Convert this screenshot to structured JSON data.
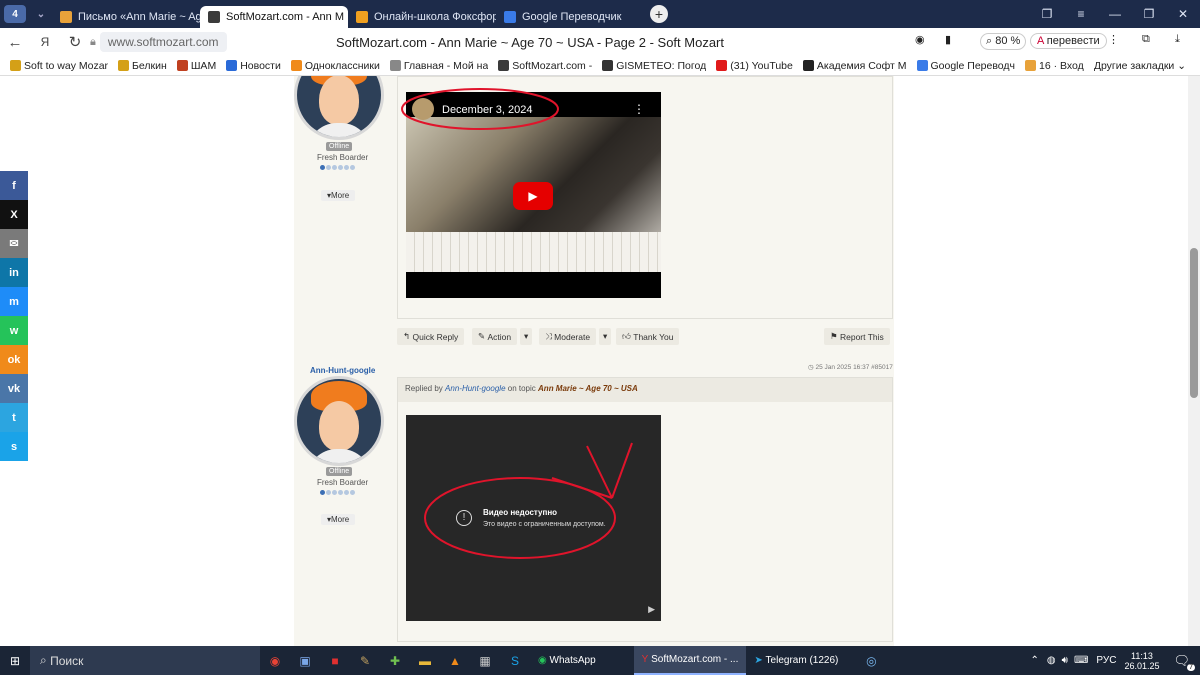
{
  "browser": {
    "tab_count": "4",
    "tabs": [
      {
        "title": "Письмо «Ann Marie ~ Age",
        "color": "#e8a23a"
      },
      {
        "title": "SoftMozart.com - Ann M",
        "color": "#3b3b3b"
      },
      {
        "title": "Онлайн-школа Фоксфорд",
        "color": "#f0a020"
      },
      {
        "title": "Google Переводчик",
        "color": "#3a7be8"
      }
    ],
    "url": "www.softmozart.com",
    "page_title": "SoftMozart.com - Ann Marie ~ Age 70 ~ USA - Page 2 - Soft Mozart",
    "zoom": "80 %",
    "translate_label": "перевести",
    "bookmarks": [
      {
        "label": "Soft to way Mozar",
        "color": "#d4a017"
      },
      {
        "label": "Белкин",
        "color": "#d4a017"
      },
      {
        "label": "ШАМ",
        "color": "#c04020"
      },
      {
        "label": "Новости",
        "color": "#2a6ad8"
      },
      {
        "label": "Одноклассники",
        "color": "#f08a1a"
      },
      {
        "label": "Главная - Мой на",
        "color": "#888888"
      },
      {
        "label": "SoftMozart.com -",
        "color": "#3b3b3b"
      },
      {
        "label": "GISMETEO: Погод",
        "color": "#333333"
      },
      {
        "label": "(31) YouTube",
        "color": "#e01a1a"
      },
      {
        "label": "Академия Софт М",
        "color": "#222222"
      },
      {
        "label": "Google Переводч",
        "color": "#3a7be8"
      },
      {
        "label": "16 · Вход",
        "color": "#e8a23a"
      }
    ],
    "other_bookmarks": "Другие закладки"
  },
  "share_buttons": [
    {
      "label": "f",
      "icon": "facebook-icon",
      "color": "#3b5998"
    },
    {
      "label": "X",
      "icon": "x-icon",
      "color": "#111111"
    },
    {
      "label": "✉",
      "icon": "email-icon",
      "color": "#7a7a7a"
    },
    {
      "label": "in",
      "icon": "linkedin-icon",
      "color": "#0e76a8"
    },
    {
      "label": "m",
      "icon": "messenger-icon",
      "color": "#1e8cf8"
    },
    {
      "label": "w",
      "icon": "whatsapp-icon",
      "color": "#25c35a"
    },
    {
      "label": "ok",
      "icon": "odnoklassniki-icon",
      "color": "#f08a1a"
    },
    {
      "label": "vk",
      "icon": "vk-icon",
      "color": "#4a76a8"
    },
    {
      "label": "t",
      "icon": "telegram-icon",
      "color": "#2ca5e0"
    },
    {
      "label": "s",
      "icon": "skype-icon",
      "color": "#1aa3e8"
    }
  ],
  "post1": {
    "status": "Offline",
    "rank": "Fresh Boarder",
    "more": "More",
    "video_date": "December 3, 2024",
    "actions": {
      "quick_reply": "Quick Reply",
      "action": "Action",
      "moderate": "Moderate",
      "thank_you": "Thank You",
      "report": "Report This"
    }
  },
  "post2": {
    "author": "Ann-Hunt-google",
    "timestamp": "25 Jan 2025 16:37 #85017",
    "replied_by": "Replied by",
    "on_topic": "on topic",
    "topic": "Ann Marie ~ Age 70 ~ USA",
    "status": "Offline",
    "rank": "Fresh Boarder",
    "more": "More",
    "video_title": "Видео недоступно",
    "video_sub": "Это видео с ограниченным доступом."
  },
  "taskbar": {
    "search": "Поиск",
    "whatsapp": "WhatsApp",
    "browser": "SoftMozart.com - ...",
    "telegram": "Telegram (1226)",
    "lang": "РУС",
    "time": "11:13",
    "date": "26.01.25",
    "notifications": "7"
  }
}
